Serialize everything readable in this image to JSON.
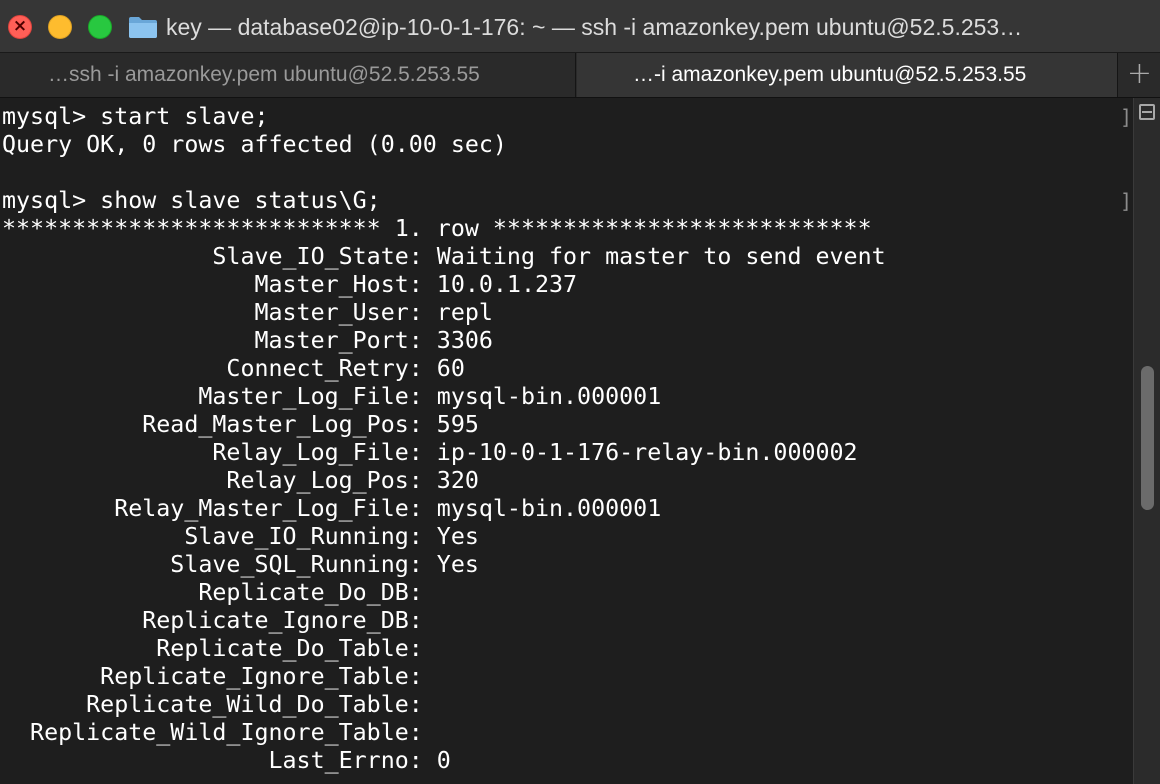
{
  "window": {
    "title": "key — database02@ip-10-0-1-176: ~ — ssh -i amazonkey.pem ubuntu@52.5.253…"
  },
  "tabs": [
    {
      "label": "…ssh -i amazonkey.pem ubuntu@52.5.253.55",
      "active": false
    },
    {
      "label": "…-i amazonkey.pem ubuntu@52.5.253.55",
      "active": true
    }
  ],
  "tabbar": {
    "new_tab_label": "+"
  },
  "icons": {
    "close": "close-icon",
    "minimize": "minimize-icon",
    "maximize": "maximize-icon",
    "folder": "folder-icon",
    "split": "split-pane-icon"
  },
  "colors": {
    "close": "#ff5f57",
    "minimize": "#febc2e",
    "maximize": "#28c840",
    "terminal_bg": "#1e1e1e",
    "terminal_fg": "#ffffff"
  },
  "terminal": {
    "lines": [
      "mysql> start slave;",
      "Query OK, 0 rows affected (0.00 sec)",
      "",
      "mysql> show slave status\\G;",
      "*************************** 1. row ***************************",
      "               Slave_IO_State: Waiting for master to send event",
      "                  Master_Host: 10.0.1.237",
      "                  Master_User: repl",
      "                  Master_Port: 3306",
      "                Connect_Retry: 60",
      "              Master_Log_File: mysql-bin.000001",
      "          Read_Master_Log_Pos: 595",
      "               Relay_Log_File: ip-10-0-1-176-relay-bin.000002",
      "                Relay_Log_Pos: 320",
      "        Relay_Master_Log_File: mysql-bin.000001",
      "             Slave_IO_Running: Yes",
      "            Slave_SQL_Running: Yes",
      "              Replicate_Do_DB: ",
      "          Replicate_Ignore_DB: ",
      "           Replicate_Do_Table: ",
      "       Replicate_Ignore_Table: ",
      "      Replicate_Wild_Do_Table: ",
      "  Replicate_Wild_Ignore_Table: ",
      "                   Last_Errno: 0"
    ],
    "marks": [
      "]",
      "]"
    ]
  }
}
